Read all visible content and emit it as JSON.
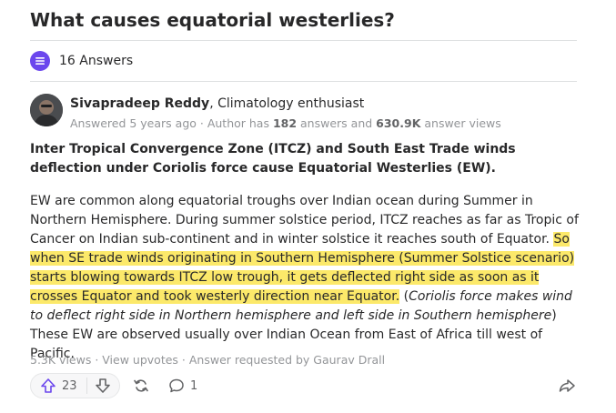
{
  "question": {
    "title": "What causes equatorial westerlies?"
  },
  "answers_header": {
    "count_label": "16 Answers"
  },
  "answer": {
    "author": {
      "name": "Sivapradeep Reddy",
      "credential": ", Climatology enthusiast"
    },
    "meta": {
      "answered": "Answered 5 years ago",
      "author_has": " · Author has ",
      "answers_count": "182",
      "answers_and": " answers and ",
      "views_count": "630.9K",
      "views_suffix": " answer views"
    },
    "lead": "Inter Tropical Convergence Zone (ITCZ) and South East Trade winds deflection under Coriolis force cause Equatorial Westerlies (EW).",
    "body": {
      "p1": "EW are common along equatorial troughs over Indian ocean during Summer in Northern Hemisphere. During summer solstice period, ITCZ reaches as far as Tropic of Cancer on Indian sub-continent and in winter solstice it reaches south of Equator. ",
      "highlight": "So when SE trade winds originating in Southern Hemisphere (Summer Solstice scenario) starts blowing towards ITCZ low trough, it gets deflected right side as soon as it crosses Equator and took westerly direction near Equator.",
      "paren_open": " (",
      "italic": "Coriolis force makes wind to deflect right side in Northern hemisphere and left side in Southern hemisphere",
      "paren_close": ")",
      "p2": "These EW are observed usually over Indian Ocean from East of Africa till west of Pacific."
    },
    "stats": {
      "views": "5.3K views",
      "view_upvotes": "View upvotes",
      "requested": "Answer requested by Gaurav Drall",
      "separator": " · "
    },
    "actions": {
      "upvotes": "23",
      "comments": "1"
    }
  },
  "colors": {
    "accent": "#6b47ed",
    "highlight": "#fce96a",
    "icon": "#636466"
  },
  "icons": [
    "answers-icon",
    "upvote-icon",
    "downvote-icon",
    "share-icon",
    "comment-icon",
    "forward-icon"
  ]
}
